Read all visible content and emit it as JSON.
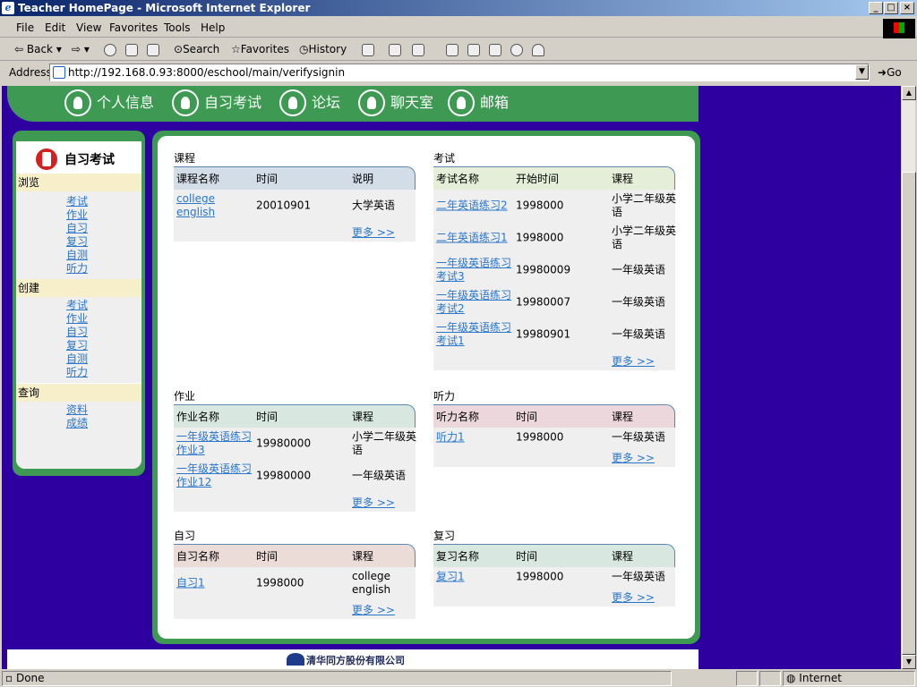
{
  "window": {
    "title": "Teacher HomePage - Microsoft Internet Explorer"
  },
  "menu": [
    "File",
    "Edit",
    "View",
    "Favorites",
    "Tools",
    "Help"
  ],
  "toolbar": {
    "back": "Back",
    "search": "Search",
    "favorites": "Favorites",
    "history": "History"
  },
  "address": {
    "label": "Address",
    "url": "http://192.168.0.93:8000/eschool/main/verifysignin",
    "go": "Go"
  },
  "nav": [
    "个人信息",
    "自习考试",
    "论坛",
    "聊天室",
    "邮箱"
  ],
  "sidebar": {
    "title": "自习考试",
    "sections": [
      {
        "label": "浏览",
        "links": [
          "考试",
          "作业",
          "自习",
          "复习",
          "自测",
          "听力"
        ]
      },
      {
        "label": "创建",
        "links": [
          "考试",
          "作业",
          "自习",
          "复习",
          "自测",
          "听力"
        ]
      },
      {
        "label": "查询",
        "links": [
          "资料",
          "成绩"
        ]
      }
    ]
  },
  "blocks": {
    "course": {
      "title": "课程",
      "headers": [
        "课程名称",
        "时间",
        "说明"
      ],
      "rows": [
        [
          "college english",
          "20010901",
          "大学英语"
        ]
      ],
      "more": "更多 >>"
    },
    "exam": {
      "title": "考试",
      "headers": [
        "考试名称",
        "开始时间",
        "课程"
      ],
      "rows": [
        [
          "二年英语练习2",
          "1998000",
          "小学二年级英语"
        ],
        [
          "二年英语练习1",
          "1998000",
          "小学二年级英语"
        ],
        [
          "一年级英语练习考试3",
          "19980009",
          "一年级英语"
        ],
        [
          "一年级英语练习考试2",
          "19980007",
          "一年级英语"
        ],
        [
          "一年级英语练习考试1",
          "19980901",
          "一年级英语"
        ]
      ],
      "more": "更多 >>"
    },
    "homework": {
      "title": "作业",
      "headers": [
        "作业名称",
        "时间",
        "课程"
      ],
      "rows": [
        [
          "一年级英语练习作业3",
          "19980000",
          "小学二年级英语"
        ],
        [
          "一年级英语练习作业12",
          "19980000",
          "一年级英语"
        ]
      ],
      "more": "更多 >>"
    },
    "listening": {
      "title": "听力",
      "headers": [
        "听力名称",
        "时间",
        "课程"
      ],
      "rows": [
        [
          "听力1",
          "1998000",
          "一年级英语"
        ]
      ],
      "more": "更多 >>"
    },
    "selfstudy": {
      "title": "自习",
      "headers": [
        "自习名称",
        "时间",
        "课程"
      ],
      "rows": [
        [
          "自习1",
          "1998000",
          "college english"
        ]
      ],
      "more": "更多 >>"
    },
    "review": {
      "title": "复习",
      "headers": [
        "复习名称",
        "时间",
        "课程"
      ],
      "rows": [
        [
          "复习1",
          "1998000",
          "一年级英语"
        ]
      ],
      "more": "更多 >>"
    }
  },
  "footer": {
    "company": "清华同方股份有限公司"
  },
  "status": {
    "text": "Done",
    "zone": "Internet"
  },
  "colors": {
    "green": "#3e9a52",
    "background": "#2e00a0",
    "link": "#2a76c9",
    "course_head": "#d3dde8",
    "exam_head": "#e4eed8",
    "homework_head": "#d8e8e0",
    "listening_head": "#ecd8dc",
    "selfstudy_head": "#ecdcd8",
    "review_head": "#d8e8e0"
  }
}
